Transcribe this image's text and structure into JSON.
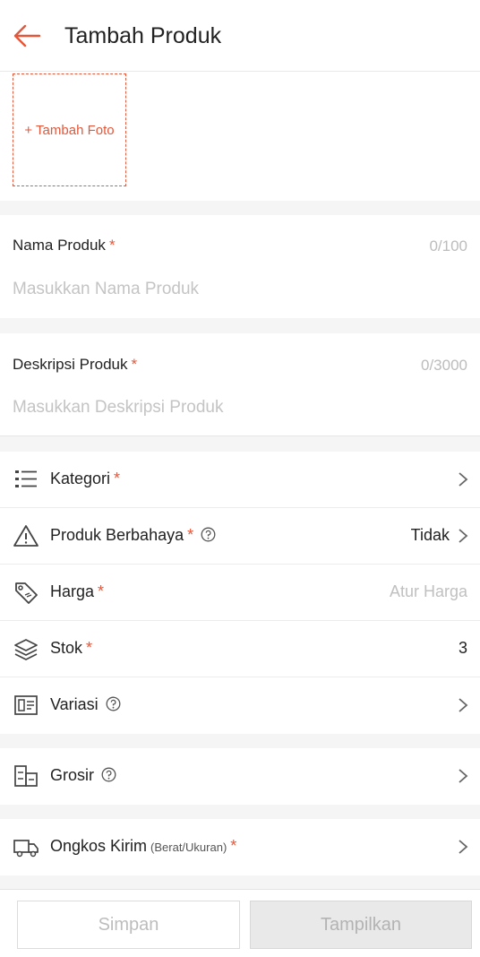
{
  "header": {
    "title": "Tambah Produk",
    "back_icon": "arrow-left-icon"
  },
  "photo": {
    "label": "+ Tambah Foto"
  },
  "name_field": {
    "label": "Nama Produk",
    "required": "*",
    "counter": "0/100",
    "placeholder": "Masukkan Nama Produk"
  },
  "desc_field": {
    "label": "Deskripsi Produk",
    "required": "*",
    "counter": "0/3000",
    "placeholder": "Masukkan Deskripsi Produk"
  },
  "rows": {
    "kategori": {
      "label": "Kategori",
      "required": "*",
      "icon": "list-icon"
    },
    "berbahaya": {
      "label": "Produk Berbahaya",
      "required": "*",
      "value": "Tidak",
      "icon": "warning-icon"
    },
    "harga": {
      "label": "Harga",
      "required": "*",
      "placeholder": "Atur Harga",
      "icon": "price-tag-icon"
    },
    "stok": {
      "label": "Stok",
      "required": "*",
      "value": "3",
      "icon": "layers-icon"
    },
    "variasi": {
      "label": "Variasi",
      "icon": "variation-icon"
    },
    "grosir": {
      "label": "Grosir",
      "icon": "wholesale-icon"
    },
    "ongkir": {
      "label": "Ongkos Kirim",
      "sub": "(Berat/Ukuran)",
      "required": "*",
      "icon": "truck-icon"
    }
  },
  "footer": {
    "save_label": "Simpan",
    "show_label": "Tampilkan"
  },
  "colors": {
    "accent": "#e4573a",
    "background": "#f5f5f5"
  }
}
